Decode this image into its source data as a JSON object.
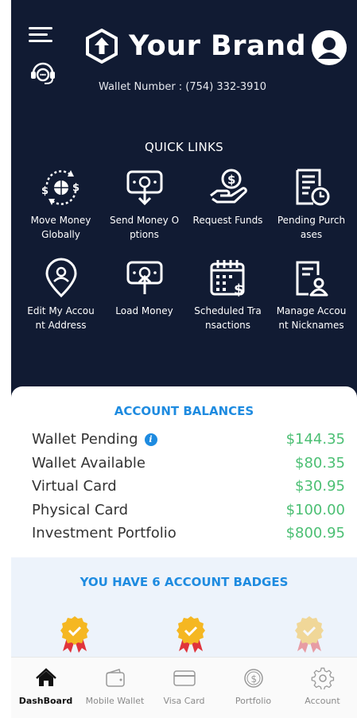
{
  "header": {
    "brand_name": "Your Brand",
    "wallet_number": "Wallet Number : (754) 332-3910",
    "icons": [
      "menu-icon",
      "support-headset-icon",
      "brand-logo-icon",
      "profile-icon"
    ]
  },
  "quick_links": {
    "title": "QUICK LINKS",
    "items": [
      {
        "label": "Move Money Globally",
        "icon": "globe-transfer-icon"
      },
      {
        "label": "Send Money Options",
        "icon": "send-money-icon"
      },
      {
        "label": "Request Funds",
        "icon": "hand-coin-icon"
      },
      {
        "label": "Pending Purchases",
        "icon": "pending-receipt-icon"
      },
      {
        "label": "Edit My Account Address",
        "icon": "location-pin-user-icon"
      },
      {
        "label": "Load Money",
        "icon": "load-money-icon"
      },
      {
        "label": "Scheduled Transactions",
        "icon": "calendar-dollar-icon"
      },
      {
        "label": "Manage Account Nicknames",
        "icon": "document-user-icon"
      }
    ]
  },
  "balances": {
    "title": "ACCOUNT BALANCES",
    "rows": [
      {
        "label": "Wallet Pending",
        "value": "$144.35",
        "info": true
      },
      {
        "label": "Wallet Available",
        "value": "$80.35"
      },
      {
        "label": "Virtual Card",
        "value": "$30.95"
      },
      {
        "label": "Physical Card",
        "value": "$100.00"
      },
      {
        "label": "Investment Portfolio",
        "value": "$800.95"
      }
    ],
    "value_color": "#4bbf73"
  },
  "badges": {
    "title": "YOU HAVE 6 ACCOUNT BADGES",
    "count": 6
  },
  "bottom_nav": {
    "items": [
      {
        "label": "DashBoard",
        "icon": "home-icon",
        "active": true
      },
      {
        "label": "Mobile Wallet",
        "icon": "wallet-icon"
      },
      {
        "label": "Visa Card",
        "icon": "credit-card-icon"
      },
      {
        "label": "Portfolio",
        "icon": "dollar-coin-icon"
      },
      {
        "label": "Account",
        "icon": "gear-icon"
      }
    ]
  },
  "colors": {
    "header_bg": "#111b33",
    "accent_blue": "#1e8be0",
    "positive_green": "#4bbf73",
    "badge_section_bg": "#edf3fb"
  }
}
